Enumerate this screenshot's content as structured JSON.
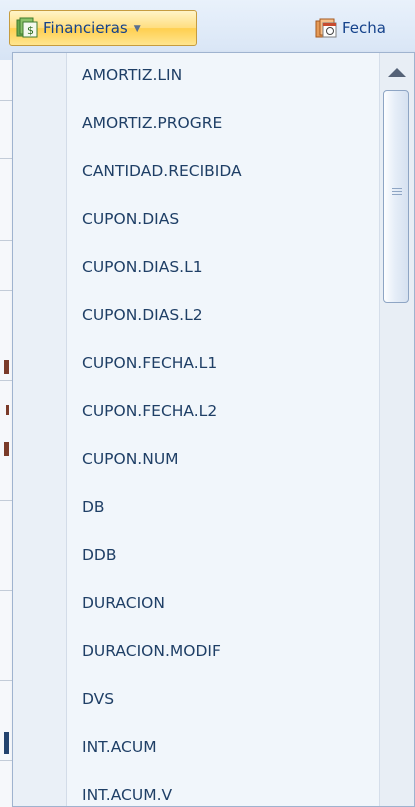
{
  "ribbon": {
    "active_button": {
      "label": "Financieras",
      "icon": "financial-book-icon",
      "caret": "dropdown-caret-icon"
    },
    "next_button": {
      "label": "Fecha",
      "icon": "calendar-book-icon"
    }
  },
  "menu": {
    "items": [
      {
        "label": "AMORTIZ.LIN"
      },
      {
        "label": "AMORTIZ.PROGRE"
      },
      {
        "label": "CANTIDAD.RECIBIDA"
      },
      {
        "label": "CUPON.DIAS"
      },
      {
        "label": "CUPON.DIAS.L1"
      },
      {
        "label": "CUPON.DIAS.L2"
      },
      {
        "label": "CUPON.FECHA.L1"
      },
      {
        "label": "CUPON.FECHA.L2"
      },
      {
        "label": "CUPON.NUM"
      },
      {
        "label": "DB"
      },
      {
        "label": "DDB"
      },
      {
        "label": "DURACION"
      },
      {
        "label": "DURACION.MODIF"
      },
      {
        "label": "DVS"
      },
      {
        "label": "INT.ACUM"
      },
      {
        "label": "INT.ACUM.V"
      }
    ]
  },
  "colors": {
    "menu_text": "#1f3f66",
    "ribbon_text": "#15428b",
    "active_button_bg": "#ffde80",
    "menu_bg": "#f1f6fb"
  }
}
